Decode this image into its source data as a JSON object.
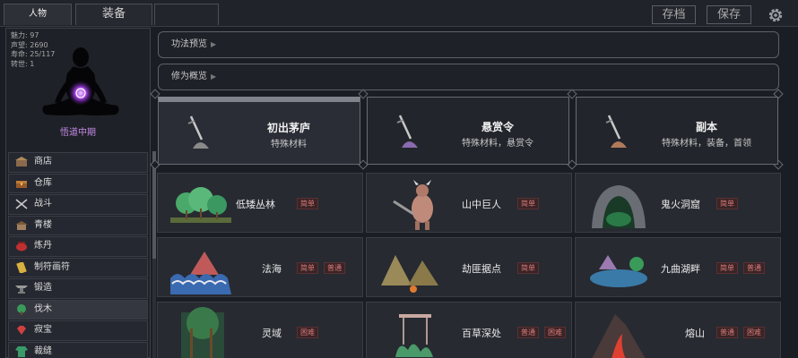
{
  "tabs": {
    "people": "人物",
    "equipment": "装备"
  },
  "top_buttons": {
    "archive": "存档",
    "save": "保存"
  },
  "character": {
    "stats": [
      {
        "label": "魅力",
        "value": "97"
      },
      {
        "label": "声望",
        "value": "2690"
      },
      {
        "label": "寿命",
        "value": "25/117"
      },
      {
        "label": "转世",
        "value": "1"
      }
    ],
    "realm": "悟道中期"
  },
  "menu": [
    {
      "label": "商店",
      "icon": "shop-icon"
    },
    {
      "label": "仓库",
      "icon": "chest-icon"
    },
    {
      "label": "战斗",
      "icon": "crossed-swords-icon"
    },
    {
      "label": "青楼",
      "icon": "house-icon"
    },
    {
      "label": "炼丹",
      "icon": "cauldron-icon"
    },
    {
      "label": "制符画符",
      "icon": "talisman-icon"
    },
    {
      "label": "锻造",
      "icon": "anvil-icon"
    },
    {
      "label": "伐木",
      "icon": "tree-icon"
    },
    {
      "label": "寂宝",
      "icon": "gem-icon"
    },
    {
      "label": "裁缝",
      "icon": "robe-icon"
    }
  ],
  "menu_active_index": 7,
  "previews": {
    "technique": "功法预览",
    "mission": "修为概览"
  },
  "categories": [
    {
      "title": "初出茅庐",
      "subtitle": "特殊材料"
    },
    {
      "title": "悬赏令",
      "subtitle": "特殊材料，悬赏令"
    },
    {
      "title": "副本",
      "subtitle": "特殊材料，装备，首领"
    }
  ],
  "locations": [
    {
      "name": "低矮丛林",
      "badges": [
        "简单"
      ]
    },
    {
      "name": "山中巨人",
      "badges": [
        "简单"
      ]
    },
    {
      "name": "鬼火洞窟",
      "badges": [
        "简单"
      ]
    },
    {
      "name": "法海",
      "badges": [
        "简单",
        "普通"
      ]
    },
    {
      "name": "劫匪据点",
      "badges": [
        "简单"
      ]
    },
    {
      "name": "九曲湖畔",
      "badges": [
        "简单",
        "普通"
      ]
    },
    {
      "name": "灵域",
      "badges": [
        "困难"
      ]
    },
    {
      "name": "百草深处",
      "badges": [
        "普通",
        "困难"
      ]
    },
    {
      "name": "熔山",
      "badges": [
        "普通",
        "困难"
      ]
    }
  ],
  "colors": {
    "accent_purple": "#c58be8",
    "badge_red": "#d87878"
  }
}
